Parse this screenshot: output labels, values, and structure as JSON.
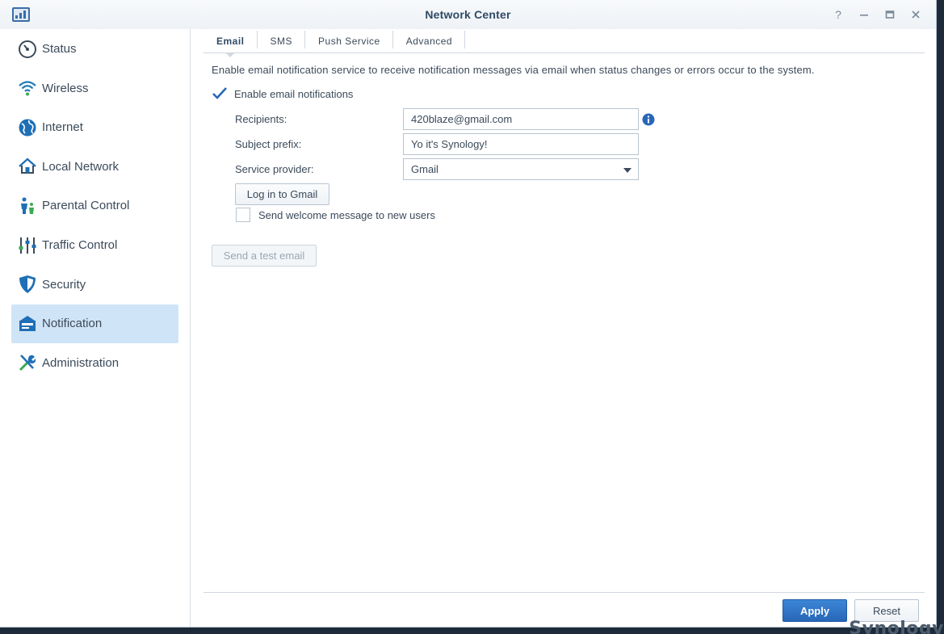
{
  "window": {
    "title": "Network Center"
  },
  "colors": {
    "accent": "#2867b8",
    "active_bg": "#cfe4f7"
  },
  "sidebar": {
    "items": [
      {
        "label": "Status",
        "icon": "gauge-icon"
      },
      {
        "label": "Wireless",
        "icon": "wifi-icon"
      },
      {
        "label": "Internet",
        "icon": "globe-icon"
      },
      {
        "label": "Local Network",
        "icon": "house-icon"
      },
      {
        "label": "Parental Control",
        "icon": "family-icon"
      },
      {
        "label": "Traffic Control",
        "icon": "sliders-icon"
      },
      {
        "label": "Security",
        "icon": "shield-icon"
      },
      {
        "label": "Notification",
        "icon": "notification-icon",
        "active": true
      },
      {
        "label": "Administration",
        "icon": "tools-icon"
      }
    ]
  },
  "tabs": [
    {
      "label": "Email",
      "active": true
    },
    {
      "label": "SMS"
    },
    {
      "label": "Push Service"
    },
    {
      "label": "Advanced"
    }
  ],
  "email": {
    "description": "Enable email notification service to receive notification messages via email when status changes or errors occur to the system.",
    "enable_label": "Enable email notifications",
    "enable_checked": true,
    "recipients_label": "Recipients:",
    "recipients_value": "420blaze@gmail.com",
    "subject_label": "Subject prefix:",
    "subject_value": "Yo it's Synology!",
    "provider_label": "Service provider:",
    "provider_value": "Gmail",
    "login_button": "Log in to Gmail",
    "welcome_label": "Send welcome message to new users",
    "welcome_checked": false,
    "test_button": "Send a test email"
  },
  "footer": {
    "apply": "Apply",
    "reset": "Reset"
  },
  "brand": "Synology"
}
